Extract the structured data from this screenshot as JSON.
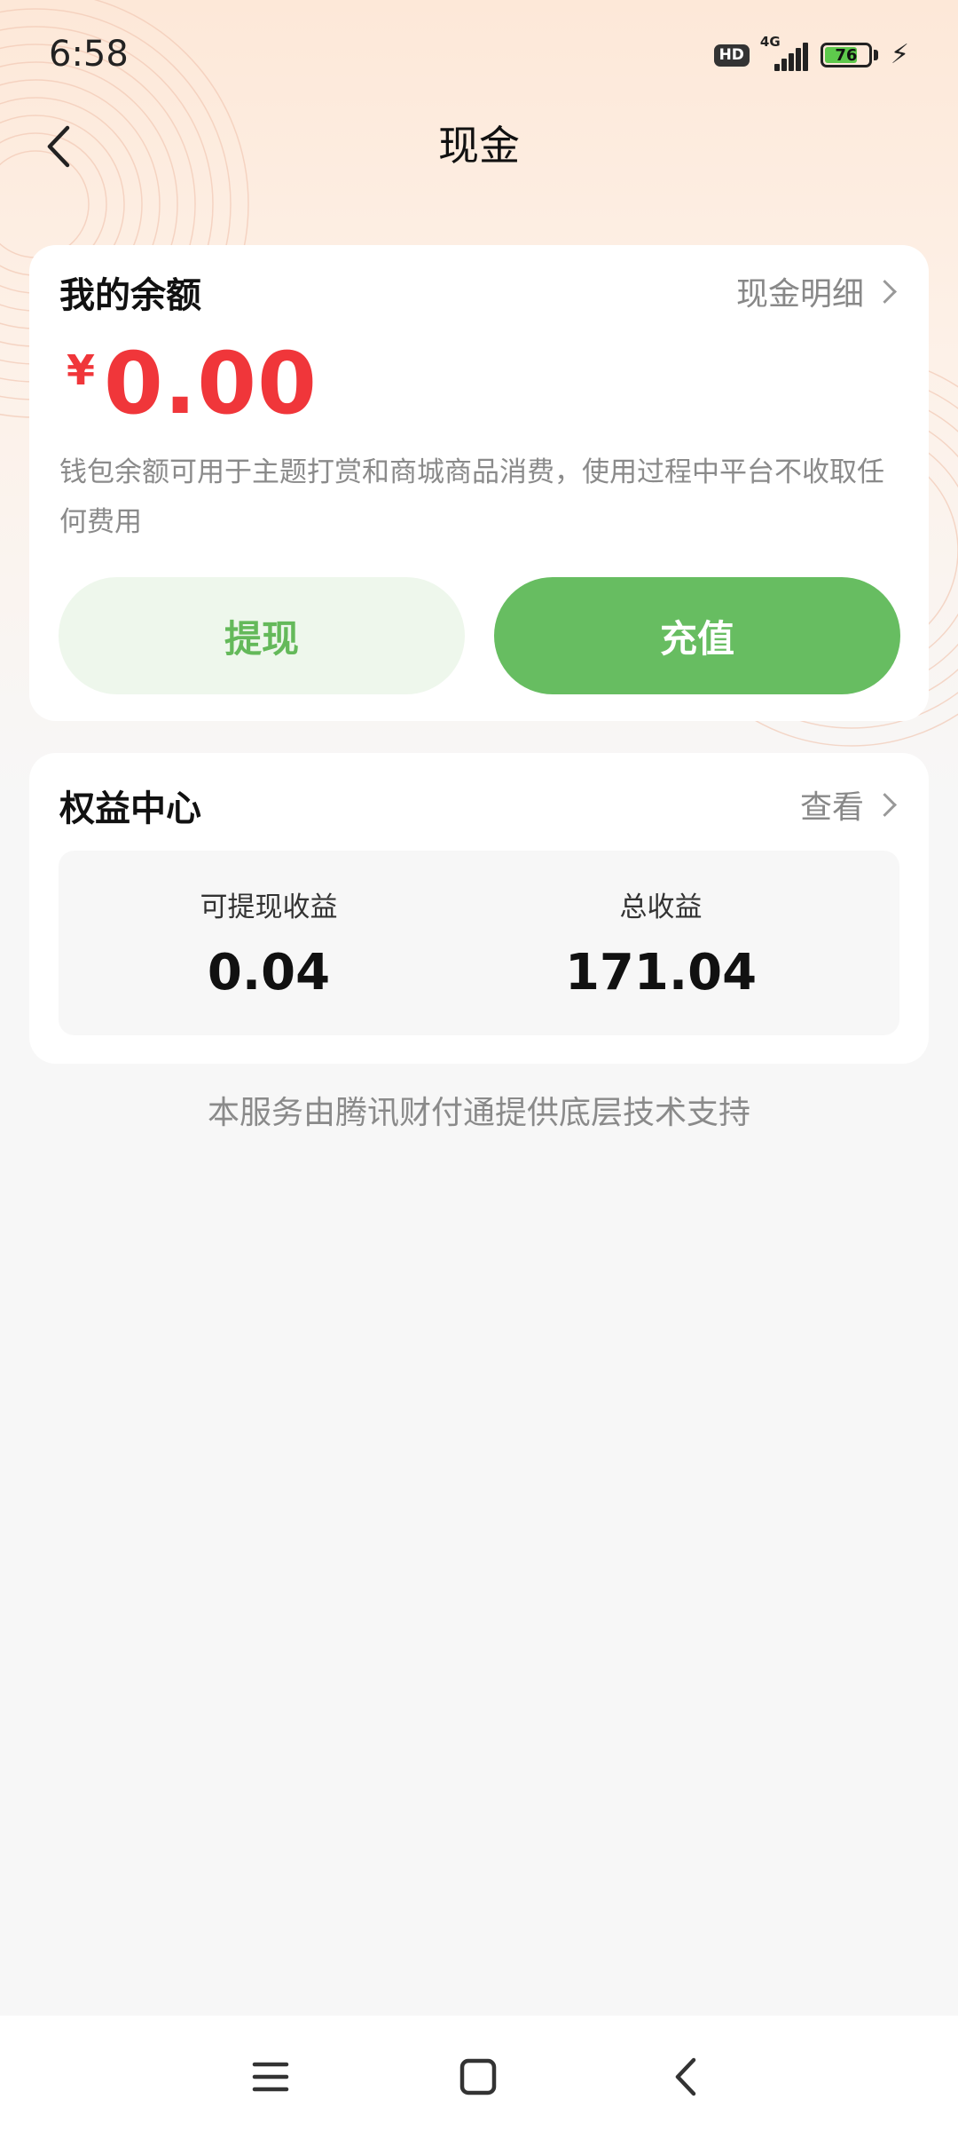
{
  "status_bar": {
    "time": "6:58",
    "hd": "HD",
    "network": "4G",
    "battery_level": 76,
    "battery_text": "76"
  },
  "header": {
    "title": "现金"
  },
  "balance": {
    "title": "我的余额",
    "details_link": "现金明细",
    "currency_symbol": "¥",
    "amount": "0.00",
    "description": "钱包余额可用于主题打赏和商城商品消费，使用过程中平台不收取任何费用",
    "withdraw_label": "提现",
    "recharge_label": "充值"
  },
  "rights": {
    "title": "权益中心",
    "view_link": "查看",
    "withdrawable_label": "可提现收益",
    "withdrawable_value": "0.04",
    "total_label": "总收益",
    "total_value": "171.04"
  },
  "footer_note": "本服务由腾讯财付通提供底层技术支持",
  "colors": {
    "accent_red": "#f0363a",
    "accent_green": "#67bd61",
    "light_green": "#eef7ec"
  }
}
